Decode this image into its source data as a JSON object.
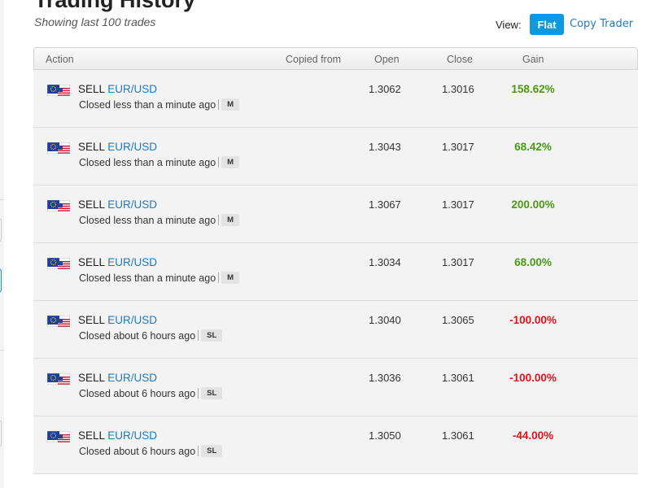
{
  "page": {
    "title": "Trading History",
    "subtitle": "Showing last 100 trades"
  },
  "view": {
    "label": "View:",
    "flat_label": "Flat",
    "copy_trader_label": "Copy Trader"
  },
  "table": {
    "headers": {
      "action": "Action",
      "copied_from": "Copied from",
      "open": "Open",
      "close": "Close",
      "gain": "Gain"
    },
    "rows": [
      {
        "side": "SELL",
        "pair": "EUR/USD",
        "closed": "Closed less than a minute ago",
        "badge": "M",
        "open": "1.3062",
        "close": "1.3016",
        "gain": "158.62%",
        "gain_sign": "pos"
      },
      {
        "side": "SELL",
        "pair": "EUR/USD",
        "closed": "Closed less than a minute ago",
        "badge": "M",
        "open": "1.3043",
        "close": "1.3017",
        "gain": "68.42%",
        "gain_sign": "pos"
      },
      {
        "side": "SELL",
        "pair": "EUR/USD",
        "closed": "Closed less than a minute ago",
        "badge": "M",
        "open": "1.3067",
        "close": "1.3017",
        "gain": "200.00%",
        "gain_sign": "pos"
      },
      {
        "side": "SELL",
        "pair": "EUR/USD",
        "closed": "Closed less than a minute ago",
        "badge": "M",
        "open": "1.3034",
        "close": "1.3017",
        "gain": "68.00%",
        "gain_sign": "pos"
      },
      {
        "side": "SELL",
        "pair": "EUR/USD",
        "closed": "Closed about 6 hours ago",
        "badge": "SL",
        "open": "1.3040",
        "close": "1.3065",
        "gain": "-100.00%",
        "gain_sign": "neg"
      },
      {
        "side": "SELL",
        "pair": "EUR/USD",
        "closed": "Closed about 6 hours ago",
        "badge": "SL",
        "open": "1.3036",
        "close": "1.3061",
        "gain": "-100.00%",
        "gain_sign": "neg"
      },
      {
        "side": "SELL",
        "pair": "EUR/USD",
        "closed": "Closed about 6 hours ago",
        "badge": "SL",
        "open": "1.3050",
        "close": "1.3061",
        "gain": "-44.00%",
        "gain_sign": "neg"
      }
    ]
  },
  "colors": {
    "accent": "#0d98e0",
    "link": "#1f7bc0",
    "gain_positive": "#4a9a12",
    "gain_negative": "#e0121a"
  },
  "icons": {
    "flag": "eu-us-flag-icon"
  }
}
